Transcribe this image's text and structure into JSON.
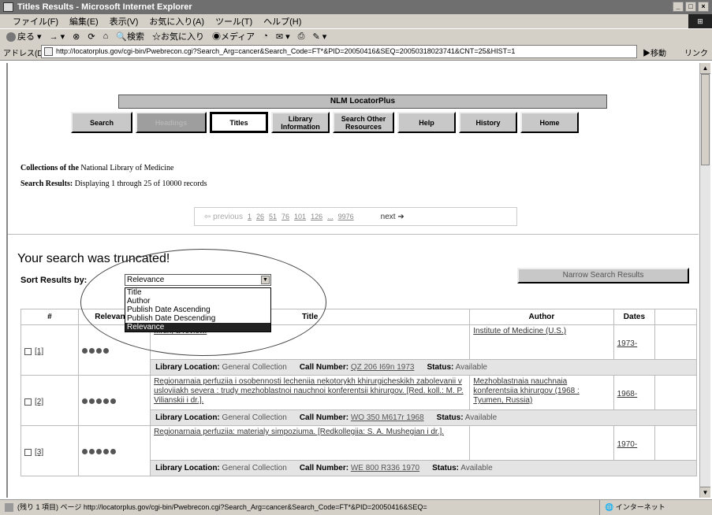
{
  "window": {
    "title": "Titles Results - Microsoft Internet Explorer",
    "buttons": [
      "_",
      "□",
      "×"
    ]
  },
  "menu": [
    "ファイル(F)",
    "編集(E)",
    "表示(V)",
    "お気に入り(A)",
    "ツール(T)",
    "ヘルプ(H)"
  ],
  "toolbar": {
    "back": "戻る",
    "search": "検索",
    "favorites": "お気に入り",
    "media": "メディア"
  },
  "address": {
    "label": "アドレス(D)",
    "url": "http://locatorplus.gov/cgi-bin/Pwebrecon.cgi?Search_Arg=cancer&Search_Code=FT*&PID=20050416&SEQ=20050318023741&CNT=25&HIST=1",
    "go": "移動",
    "links": "リンク"
  },
  "page": {
    "nlm_title": "NLM LocatorPlus",
    "nav": [
      {
        "label": "Search",
        "state": "normal"
      },
      {
        "label": "Headings",
        "state": "dim"
      },
      {
        "label": "Titles",
        "state": "active"
      },
      {
        "label": "Library Information",
        "state": "normal"
      },
      {
        "label": "Search Other Resources",
        "state": "normal"
      },
      {
        "label": "Help",
        "state": "normal"
      },
      {
        "label": "History",
        "state": "normal"
      },
      {
        "label": "Home",
        "state": "normal"
      }
    ],
    "collections_label": "Collections of the",
    "collections_value": "National Library of Medicine",
    "search_results_label": "Search Results:",
    "search_results_value": "Displaying 1 through 25 of 10000 records",
    "pager": {
      "previous": "previous",
      "pages": [
        "1",
        "26",
        "51",
        "76",
        "101",
        "126",
        "...",
        "9976"
      ],
      "next": "next"
    },
    "truncated": "Your search was truncated!",
    "sort_label": "Sort Results by:",
    "sort_value": "Relevance",
    "sort_options": [
      "Title",
      "Author",
      "Publish Date Ascending",
      "Publish Date Descending",
      "Relevance"
    ],
    "sort_selected_index": 4,
    "narrow_button": "Narrow Search Results",
    "columns": [
      "#",
      "Relevance",
      "Title",
      "Author",
      "Dates"
    ],
    "results": [
      {
        "num": "[1]",
        "relevance": 4,
        "title": "...rtin, a review.",
        "author": "Institute of Medicine (U.S.)",
        "dates": "1973-",
        "location_label": "Library Location:",
        "location": "General Collection",
        "call_label": "Call Number:",
        "call": "QZ 206 I69n 1973",
        "status_label": "Status:",
        "status": "Available"
      },
      {
        "num": "[2]",
        "relevance": 5,
        "title": "Regionarnaia perfuziia i osobennosti lecheniia nekotorykh khirurgicheskikh zabolevanii v usloviiakh severa : trudy mezhoblastnoi nauchnoi konferentsii khirurgov. [Red. koll.: M. P. Vilianskii i dr.].",
        "author": "Mezhoblastnaia nauchnaia konferentsiia khirurgov (1968 : Tyumen, Russia)",
        "dates": "1968-",
        "location_label": "Library Location:",
        "location": "General Collection",
        "call_label": "Call Number:",
        "call": "WO 350 M617r 1968",
        "status_label": "Status:",
        "status": "Available"
      },
      {
        "num": "[3]",
        "relevance": 5,
        "title": "Regionarnaia perfuziia: materialy simpoziuma. [Redkollegiia: S. A. Mushegian i dr.].",
        "author": "",
        "dates": "1970-",
        "location_label": "Library Location:",
        "location": "General Collection",
        "call_label": "Call Number:",
        "call": "WE 800 R336 1970",
        "status_label": "Status:",
        "status": "Available"
      }
    ]
  },
  "status": {
    "text": "(残り 1 項目) ページ http://locatorplus.gov/cgi-bin/Pwebrecon.cgi?Search_Arg=cancer&Search_Code=FT*&PID=20050416&SEQ=",
    "zone": "インターネット"
  }
}
